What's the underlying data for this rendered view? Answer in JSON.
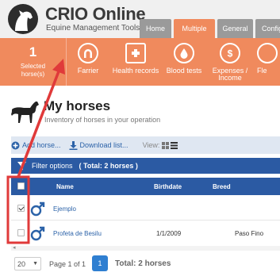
{
  "brand": {
    "name": "CRIO Online",
    "tagline": "Equine Management Tools"
  },
  "tabs": [
    {
      "label": "Home",
      "active": false
    },
    {
      "label": "Multiple",
      "active": true
    },
    {
      "label": "General",
      "active": false
    },
    {
      "label": "Config",
      "active": false
    }
  ],
  "toolbar": {
    "selected_count": "1",
    "selected_label_line1": "Selected",
    "selected_label_line2": "horse(s)",
    "tools": [
      {
        "label": "Farrier",
        "icon": "horseshoe-icon"
      },
      {
        "label": "Health records",
        "icon": "medical-kit-icon"
      },
      {
        "label": "Blood tests",
        "icon": "blood-drop-icon"
      },
      {
        "label_line1": "Expenses /",
        "label_line2": "Income",
        "icon": "dollar-icon"
      },
      {
        "label": "Fle",
        "icon": "partial-icon"
      }
    ]
  },
  "title": {
    "heading": "My horses",
    "subtitle": "Inventory of horses in your operation"
  },
  "actions": {
    "add": "Add horse...",
    "download": "Download list...",
    "view_label": "View:"
  },
  "filter": {
    "label": "Filter options",
    "total": "( Total: 2 horses )"
  },
  "table": {
    "columns": [
      "Name",
      "Birthdate",
      "Breed"
    ],
    "rows": [
      {
        "checked": true,
        "sex_icon": "male-icon",
        "name": "Ejemplo",
        "birthdate": "",
        "breed": ""
      },
      {
        "checked": false,
        "sex_icon": "male-icon",
        "name": "Profeta de Besilu",
        "birthdate": "1/1/2009",
        "breed": "Paso Fino"
      }
    ]
  },
  "pager": {
    "page_size": "20",
    "page_info": "Page 1 of 1",
    "current_page": "1",
    "total": "Total: 2 horses"
  },
  "colors": {
    "orange": "#f08a5d",
    "blue": "#2b5aa3",
    "annotation_red": "#e03a3a"
  }
}
